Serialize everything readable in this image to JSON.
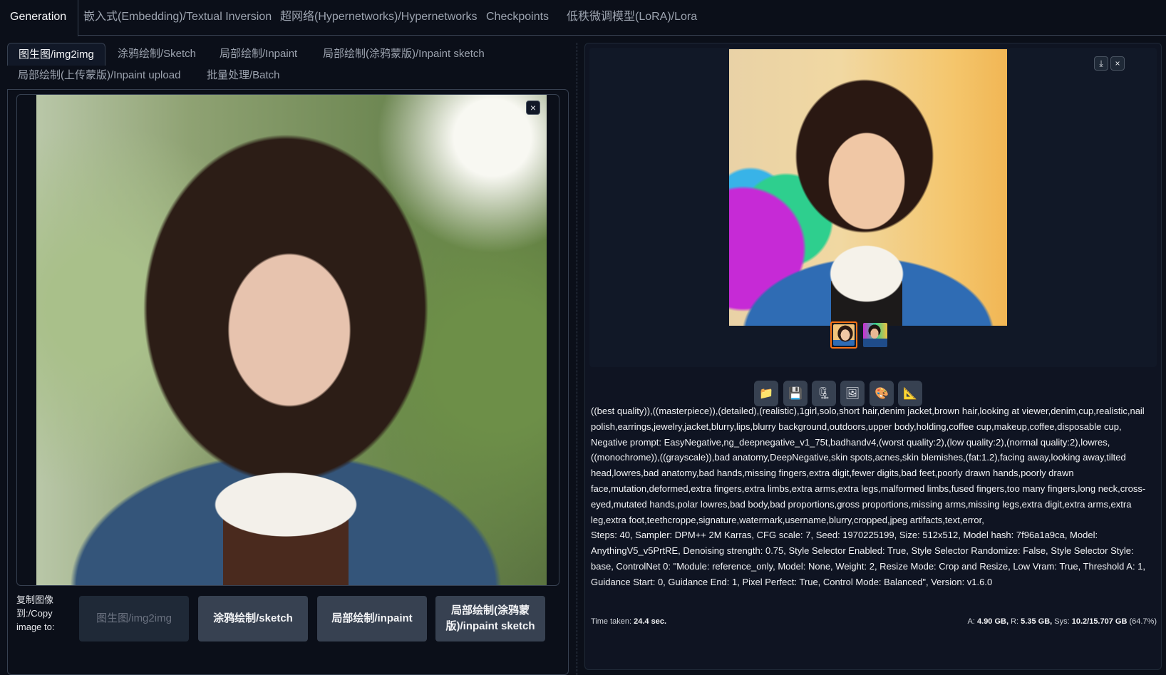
{
  "top_tabs": [
    {
      "label": "Generation",
      "active": true
    },
    {
      "label": "嵌入式(Embedding)/Textual Inversion"
    },
    {
      "label": "超网络(Hypernetworks)/Hypernetworks"
    },
    {
      "label": "Checkpoints"
    },
    {
      "label": "低秩微调模型(LoRA)/Lora"
    }
  ],
  "sub_tabs": [
    {
      "label": "图生图/img2img",
      "active": true
    },
    {
      "label": "涂鸦绘制/Sketch"
    },
    {
      "label": "局部绘制/Inpaint"
    },
    {
      "label": "局部绘制(涂鸦蒙版)/Inpaint sketch"
    },
    {
      "label": "局部绘制(上传蒙版)/Inpaint upload"
    },
    {
      "label": "批量处理/Batch"
    }
  ],
  "image_input": {
    "close_label": "×"
  },
  "copy_image": {
    "label": "复制图像到:/Copy image to:",
    "buttons": [
      {
        "label": "图生图/img2img",
        "disabled": true
      },
      {
        "label": "涂鸦绘制/sketch"
      },
      {
        "label": "局部绘制/inpaint"
      },
      {
        "label": "局部绘制(涂鸦蒙版)/inpaint sketch"
      }
    ]
  },
  "gallery": {
    "download_label": "⤓",
    "close_label": "×",
    "thumbnails": 2,
    "selected_thumbnail": 0
  },
  "tool_buttons": [
    {
      "icon": "folder-icon",
      "glyph": "📁"
    },
    {
      "icon": "save-icon",
      "glyph": "💾"
    },
    {
      "icon": "zip-icon",
      "glyph": "🗜"
    },
    {
      "icon": "send-to-img2img-icon",
      "glyph": "🖼"
    },
    {
      "icon": "send-to-inpaint-icon",
      "glyph": "🎨"
    },
    {
      "icon": "send-to-extras-icon",
      "glyph": "📐"
    }
  ],
  "generation_info": {
    "prompt": "((best quality)),((masterpiece)),(detailed),(realistic),1girl,solo,short hair,denim jacket,brown hair,looking at viewer,denim,cup,realistic,nail polish,earrings,jewelry,jacket,blurry,lips,blurry background,outdoors,upper body,holding,coffee cup,makeup,coffee,disposable cup,",
    "negative_prompt": "Negative prompt: EasyNegative,ng_deepnegative_v1_75t,badhandv4,(worst quality:2),(low quality:2),(normal quality:2),lowres,((monochrome)),((grayscale)),bad anatomy,DeepNegative,skin spots,acnes,skin blemishes,(fat:1.2),facing away,looking away,tilted head,lowres,bad anatomy,bad hands,missing fingers,extra digit,fewer digits,bad feet,poorly drawn hands,poorly drawn face,mutation,deformed,extra fingers,extra limbs,extra arms,extra legs,malformed limbs,fused fingers,too many fingers,long neck,cross-eyed,mutated hands,polar lowres,bad body,bad proportions,gross proportions,missing arms,missing legs,extra digit,extra arms,extra leg,extra foot,teethcroppe,signature,watermark,username,blurry,cropped,jpeg artifacts,text,error,",
    "params": "Steps: 40, Sampler: DPM++ 2M Karras, CFG scale: 7, Seed: 1970225199, Size: 512x512, Model hash: 7f96a1a9ca, Model: AnythingV5_v5PrtRE, Denoising strength: 0.75, Style Selector Enabled: True, Style Selector Randomize: False, Style Selector Style: base, ControlNet 0: \"Module: reference_only, Model: None, Weight: 2, Resize Mode: Crop and Resize, Low Vram: True, Threshold A: 1, Guidance Start: 0, Guidance End: 1, Pixel Perfect: True, Control Mode: Balanced\", Version: v1.6.0"
  },
  "footer": {
    "time_label": "Time taken:",
    "time_value": "24.4 sec.",
    "mem_a_label": "A:",
    "mem_a": "4.90 GB,",
    "mem_r_label": "R:",
    "mem_r": "5.35 GB,",
    "mem_sys_label": "Sys:",
    "mem_sys": "10.2/15.707 GB",
    "mem_pct": "(64.7%)"
  },
  "colors": {
    "background": "#0b0f19",
    "panel": "#111827",
    "border": "#374151",
    "button": "#374151",
    "selected_thumbnail": "#f97316"
  }
}
